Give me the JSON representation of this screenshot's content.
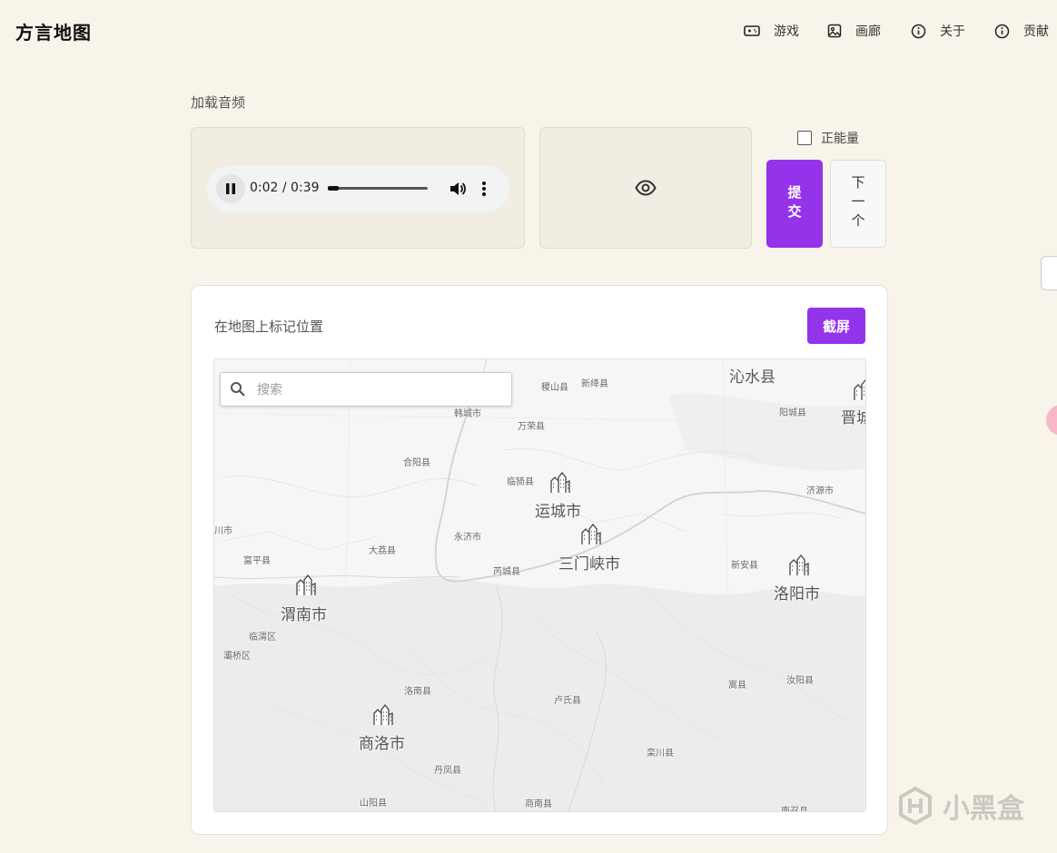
{
  "header": {
    "title": "方言地图",
    "nav": [
      {
        "label": "游戏",
        "icon": "gamepad-icon"
      },
      {
        "label": "画廊",
        "icon": "image-icon"
      },
      {
        "label": "关于",
        "icon": "info-icon"
      },
      {
        "label": "贡献",
        "icon": "info-icon"
      }
    ]
  },
  "audio": {
    "section_label": "加载音频",
    "time": "0:02 / 0:39",
    "progress": 0.05
  },
  "controls": {
    "checkbox_label": "正能量",
    "checkbox_checked": false,
    "submit_label": "提交",
    "next_label": "下一个"
  },
  "map_card": {
    "label": "在地图上标记位置",
    "screenshot_label": "截屏",
    "search_placeholder": "搜索",
    "cities": [
      "沁水县",
      "晋城",
      "运城市",
      "三门峡市",
      "洛阳市",
      "渭南市",
      "商洛市"
    ],
    "counties": [
      "稷山县",
      "新绛县",
      "阳城县",
      "韩城市",
      "万荣县",
      "合阳县",
      "临猗县",
      "济源市",
      "永济市",
      "大荔县",
      "芮城县",
      "新安县",
      "富平县",
      "川市",
      "临渭区",
      "灞桥区",
      "洛南县",
      "卢氏县",
      "嵩县",
      "汝阳县",
      "栾川县",
      "丹凤县",
      "山阳县",
      "商南县",
      "南召县"
    ]
  },
  "watermark": "小黑盒"
}
